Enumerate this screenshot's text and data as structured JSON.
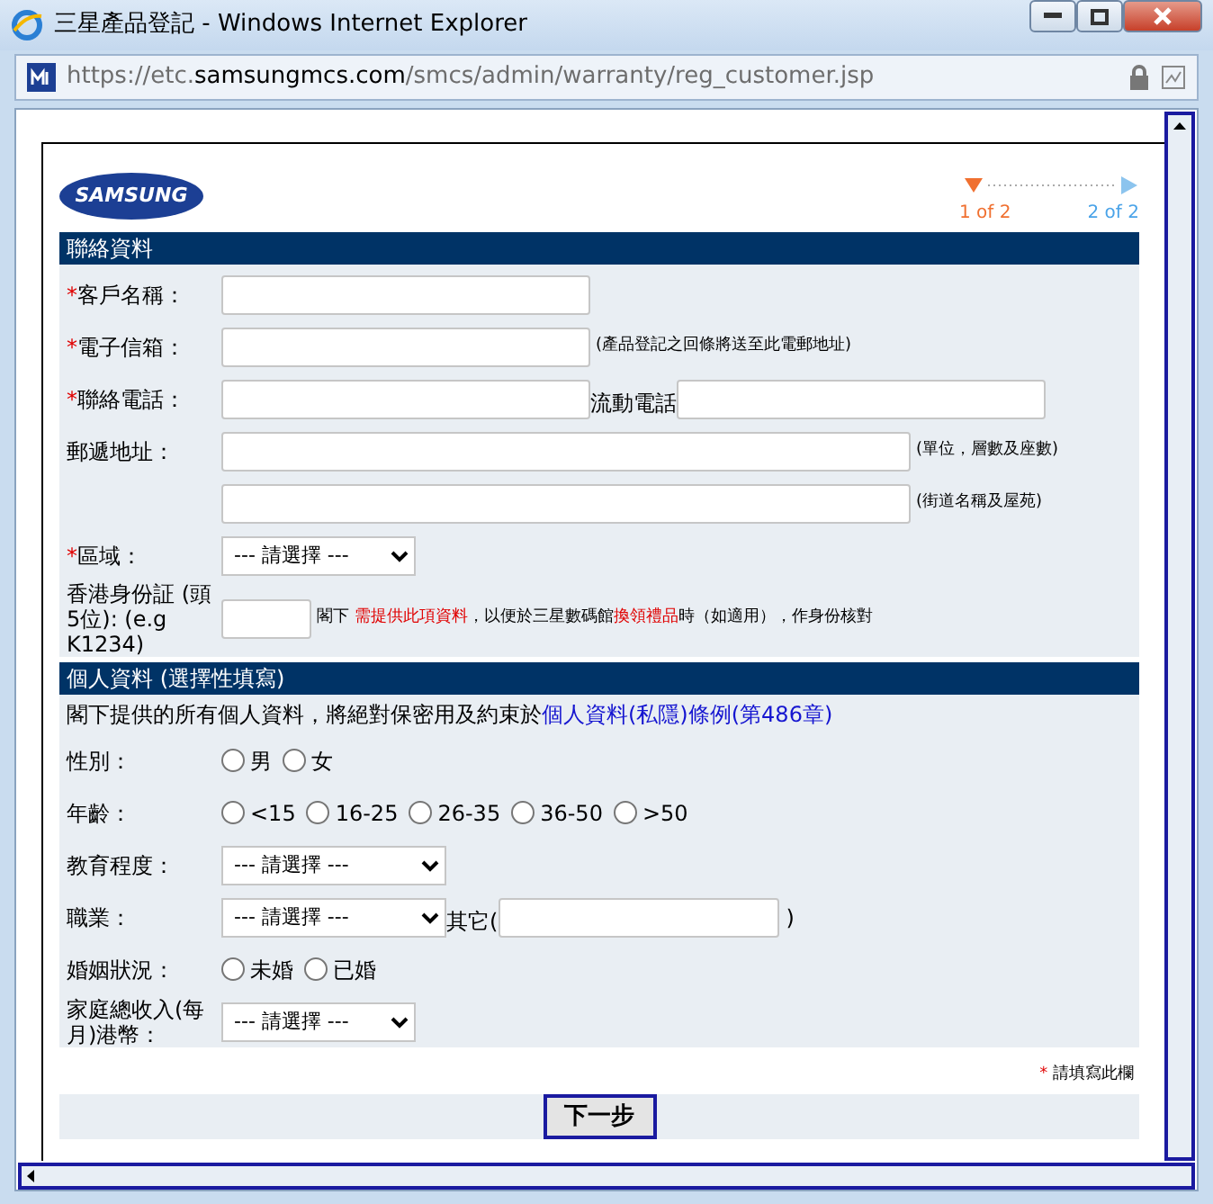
{
  "window": {
    "title": "三星產品登記 - Windows Internet Explorer",
    "url": {
      "prefix": "https://etc.",
      "domain": "samsungmcs.com",
      "path": "/smcs/admin/warranty/reg_customer.jsp"
    }
  },
  "logo": "SAMSUNG",
  "steps": [
    {
      "label": "1 of 2",
      "selected": true
    },
    {
      "label": "2 of 2",
      "selected": false
    }
  ],
  "required_mark": "*",
  "sections": [
    {
      "title": "聯絡資料",
      "rows": [
        {
          "label": "客戶名稱：",
          "required": true,
          "controls": [
            {
              "kind": "input"
            }
          ]
        },
        {
          "label": "電子信箱：",
          "required": true,
          "controls": [
            {
              "kind": "input"
            },
            {
              "kind": "note",
              "text": "(產品登記之回條將送至此電郵地址)"
            }
          ]
        },
        {
          "label": "聯絡電話：",
          "required": true,
          "controls": [
            {
              "kind": "input"
            },
            {
              "kind": "text",
              "text": "流動電話"
            },
            {
              "kind": "input"
            }
          ]
        },
        {
          "label": "郵遞地址：",
          "required": false,
          "controls": [
            {
              "kind": "wideinput"
            },
            {
              "kind": "note",
              "text": "(單位，層數及座數)"
            }
          ]
        },
        {
          "controls": [
            {
              "kind": "wideinput"
            },
            {
              "kind": "note",
              "text": "(街道名稱及屋苑)"
            }
          ]
        },
        {
          "label": "區域：",
          "required": true,
          "controls": [
            {
              "kind": "select",
              "value": "--- 請選擇 ---"
            }
          ]
        },
        {
          "label": "香港身份証 (頭5位): (e.g K1234)",
          "required": false,
          "controls": [
            {
              "kind": "tinyinput"
            },
            {
              "kind": "note",
              "text": "閣下 **需提供此項資料**，以便於三星數碼館**換領禮品**時（如適用），作身份核對"
            }
          ]
        }
      ]
    },
    {
      "title": "個人資料 (選擇性填寫)",
      "intro": {
        "text": "閣下提供的所有個人資料，將絕對保密用及約束於",
        "link": "個人資料(私隱)條例(第486章)"
      },
      "rows": [
        {
          "label": "性別：",
          "required": false,
          "controls": [
            {
              "kind": "radio",
              "label": "男",
              "checked": false
            },
            {
              "kind": "radio",
              "label": "女",
              "checked": false
            }
          ]
        },
        {
          "label": "年齡：",
          "required": false,
          "controls": [
            {
              "kind": "radio",
              "label": "<15",
              "checked": false
            },
            {
              "kind": "radio",
              "label": "16-25",
              "checked": false
            },
            {
              "kind": "radio",
              "label": "26-35",
              "checked": false
            },
            {
              "kind": "radio",
              "label": "36-50",
              "checked": false
            },
            {
              "kind": "radio",
              "label": ">50",
              "checked": false
            }
          ]
        },
        {
          "label": "教育程度：",
          "required": false,
          "controls": [
            {
              "kind": "wideselect",
              "value": "--- 請選擇 ---"
            }
          ]
        },
        {
          "label": "職業：",
          "required": false,
          "controls": [
            {
              "kind": "wideselect",
              "value": "--- 請選擇 ---"
            },
            {
              "kind": "text",
              "text": "其它("
            },
            {
              "kind": "midinput"
            },
            {
              "kind": "text",
              "text": ")"
            }
          ]
        },
        {
          "label": "婚姻狀況：",
          "required": false,
          "controls": [
            {
              "kind": "radio",
              "label": "未婚",
              "checked": false
            },
            {
              "kind": "radio",
              "label": "已婚",
              "checked": false
            }
          ]
        },
        {
          "label": "家庭總收入(每月)港幣：",
          "required": false,
          "controls": [
            {
              "kind": "select",
              "value": "--- 請選擇 ---"
            }
          ]
        }
      ]
    }
  ],
  "footer_note": "請填寫此欄",
  "button": "下一步"
}
